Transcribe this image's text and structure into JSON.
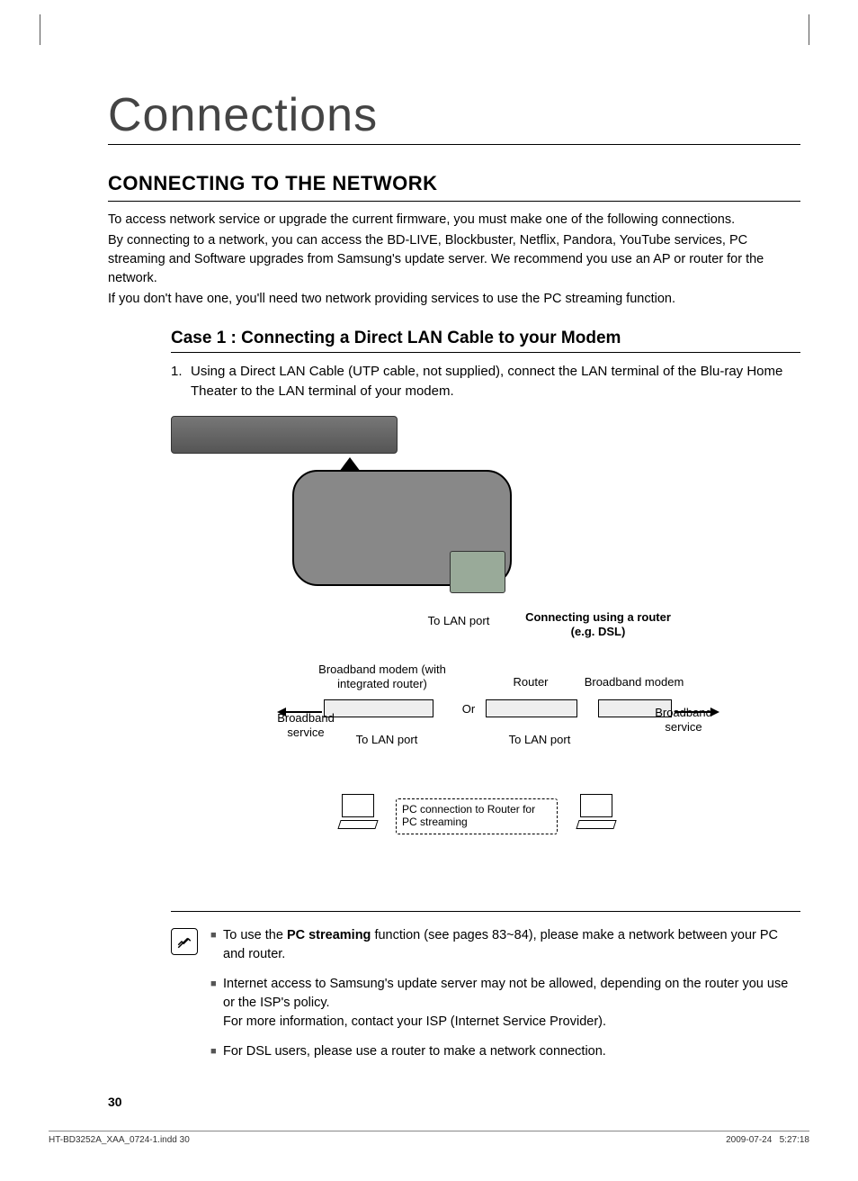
{
  "title": "Connections",
  "section_title": "CONNECTING TO THE NETWORK",
  "intro": {
    "p1": "To access network service or upgrade the current firmware, you must make one of the following connections.",
    "p2": "By connecting to a network, you can access the BD-LIVE, Blockbuster, Netflix, Pandora, YouTube services, PC streaming and Software upgrades from Samsung's update server. We recommend you use an AP or router for the network.",
    "p3": "If you don't have one, you'll need two network providing services to use the PC streaming function."
  },
  "case": {
    "title": "Case 1 : Connecting a Direct LAN Cable to your Modem",
    "step_num": "1.",
    "step_text": "Using a Direct LAN Cable (UTP cable, not supplied), connect the LAN terminal of the Blu-ray Home Theater to the LAN terminal of your modem."
  },
  "diagram": {
    "to_lan_port": "To LAN port",
    "connecting_router": "Connecting using a router (e.g. DSL)",
    "broadband_modem_integrated": "Broadband modem (with integrated router)",
    "router": "Router",
    "broadband_modem": "Broadband modem",
    "or": "Or",
    "broadband_service": "Broadband service",
    "pc_connection": "PC connection to Router for PC streaming"
  },
  "notes": {
    "n1a": "To use the ",
    "n1b": "PC streaming",
    "n1c": " function (see pages 83~84), please make a network between your PC and router.",
    "n2a": "Internet access to Samsung's update server may not be allowed, depending on the router you use or the ISP's policy.",
    "n2b": "For more information, contact your ISP (Internet Service Provider).",
    "n3": "For DSL users, please use a router to make a network connection."
  },
  "page_number": "30",
  "footer": {
    "left": "HT-BD3252A_XAA_0724-1.indd   30",
    "date": "2009-07-24",
    "time": "5:27:18"
  }
}
